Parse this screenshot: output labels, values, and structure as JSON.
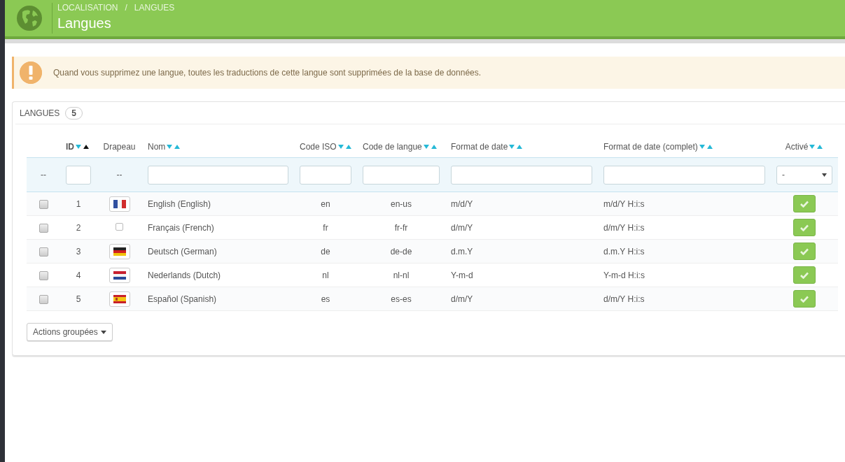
{
  "header": {
    "breadcrumb": [
      "LOCALISATION",
      "/",
      "LANGUES"
    ],
    "title": "Langues"
  },
  "alert": {
    "kind": "warning",
    "text": "Quand vous supprimez une langue, toutes les traductions de cette langue sont supprimées de la base de données."
  },
  "panel": {
    "title": "LANGUES",
    "count": "5"
  },
  "table": {
    "columns": [
      {
        "kind": "check",
        "filter": {
          "kind": "dashes",
          "text": "--"
        }
      },
      {
        "kind": "centered",
        "label": "ID",
        "sorted": true,
        "filter": {
          "kind": "input"
        }
      },
      {
        "kind": "flag",
        "label": "Drapeau",
        "filter": {
          "kind": "dashes",
          "text": "--"
        }
      },
      {
        "kind": "text",
        "label": "Nom",
        "sorted": false,
        "filter": {
          "kind": "input"
        }
      },
      {
        "kind": "centered",
        "label": "Code ISO",
        "sorted": false,
        "filter": {
          "kind": "input"
        }
      },
      {
        "kind": "centered",
        "label": "Code de langue",
        "sorted": false,
        "filter": {
          "kind": "input"
        }
      },
      {
        "kind": "text",
        "label": "Format de date",
        "sorted": false,
        "filter": {
          "kind": "input"
        }
      },
      {
        "kind": "text",
        "label": "Format de date (complet)",
        "sorted": false,
        "filter": {
          "kind": "input"
        }
      },
      {
        "kind": "status",
        "label": "Activé",
        "sorted": false,
        "filter": {
          "kind": "select",
          "value": "-"
        }
      }
    ],
    "rows": [
      {
        "cells": [
          {
            "checked": false
          },
          "1",
          {
            "kind": "fr"
          },
          "English (English)",
          "en",
          "en-us",
          "m/d/Y",
          "m/d/Y H:i:s",
          {
            "active": true
          }
        ]
      },
      {
        "cells": [
          {
            "checked": false
          },
          "2",
          {
            "kind": "broken"
          },
          "Français (French)",
          "fr",
          "fr-fr",
          "d/m/Y",
          "d/m/Y H:i:s",
          {
            "active": true
          }
        ]
      },
      {
        "cells": [
          {
            "checked": false
          },
          "3",
          {
            "kind": "de"
          },
          "Deutsch (German)",
          "de",
          "de-de",
          "d.m.Y",
          "d.m.Y H:i:s",
          {
            "active": true
          }
        ]
      },
      {
        "cells": [
          {
            "checked": false
          },
          "4",
          {
            "kind": "nl"
          },
          "Nederlands (Dutch)",
          "nl",
          "nl-nl",
          "Y-m-d",
          "Y-m-d H:i:s",
          {
            "active": true
          }
        ]
      },
      {
        "cells": [
          {
            "checked": false
          },
          "5",
          {
            "kind": "es"
          },
          "Español (Spanish)",
          "es",
          "es-es",
          "d/m/Y",
          "d/m/Y H:i:s",
          {
            "active": true
          }
        ]
      }
    ]
  },
  "bulk_button": {
    "label": "Actions groupées"
  }
}
